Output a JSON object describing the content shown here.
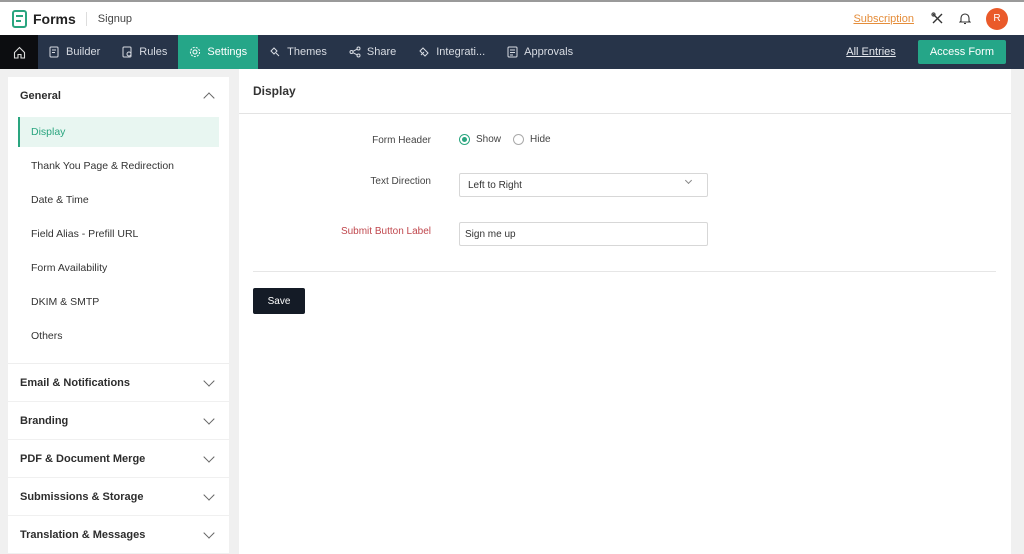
{
  "header": {
    "app_title": "Forms",
    "form_name": "Signup",
    "subscription_link": "Subscription",
    "avatar_initial": "R",
    "icons": [
      "forms-logo-icon",
      "tools-icon",
      "bell-icon"
    ]
  },
  "nav": {
    "home_icon": "home-icon",
    "items": [
      {
        "label": "Builder",
        "icon": "builder-icon"
      },
      {
        "label": "Rules",
        "icon": "rules-icon"
      },
      {
        "label": "Settings",
        "icon": "gear-icon",
        "active": true
      },
      {
        "label": "Themes",
        "icon": "themes-icon"
      },
      {
        "label": "Share",
        "icon": "share-icon"
      },
      {
        "label": "Integrati...",
        "icon": "integrations-icon"
      },
      {
        "label": "Approvals",
        "icon": "approvals-icon"
      }
    ],
    "all_entries": "All Entries",
    "access_form": "Access Form"
  },
  "sidebar": {
    "general": {
      "title": "General",
      "expanded": true,
      "items": [
        {
          "label": "Display",
          "active": true
        },
        {
          "label": "Thank You Page & Redirection"
        },
        {
          "label": "Date & Time"
        },
        {
          "label": "Field Alias - Prefill URL"
        },
        {
          "label": "Form Availability"
        },
        {
          "label": "DKIM & SMTP"
        },
        {
          "label": "Others"
        }
      ]
    },
    "groups": [
      {
        "label": "Email & Notifications"
      },
      {
        "label": "Branding"
      },
      {
        "label": "PDF & Document Merge"
      },
      {
        "label": "Submissions & Storage"
      },
      {
        "label": "Translation & Messages"
      }
    ]
  },
  "main": {
    "title": "Display",
    "form_header": {
      "label": "Form Header",
      "options": [
        "Show",
        "Hide"
      ],
      "selected": "Show"
    },
    "text_direction": {
      "label": "Text Direction",
      "value": "Left to Right"
    },
    "submit_label": {
      "label": "Submit Button Label",
      "value": "Sign me up"
    },
    "save_label": "Save"
  },
  "colors": {
    "accent": "#25a688",
    "navbar": "#273449",
    "subscription": "#e58d3a",
    "avatar": "#ea5a2a",
    "required_label": "#c0474d",
    "save_button": "#141b26"
  }
}
